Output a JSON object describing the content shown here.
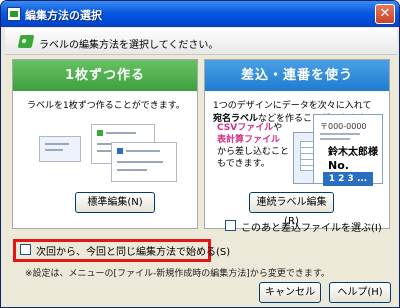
{
  "window": {
    "title": "編集方法の選択",
    "close_glyph": "✕"
  },
  "header": {
    "instruction": "ラベルの編集方法を選択してください。"
  },
  "panel_single": {
    "title": "1枚ずつ作る",
    "description": "ラベルを1枚ずつ作ることができます。",
    "button_label": "標準編集(N)"
  },
  "panel_merge": {
    "title": "差込・連番を使う",
    "description_line1": "1つのデザインにデータを次々に入れて",
    "description_bold": "宛名ラベル",
    "description_line2_rest": "などを作ることができます。",
    "csv_line1": "CSVファイル",
    "csv_line1_suffix": "や",
    "csv_line2": "表計算ファイル",
    "csv_line3": "から差し込むこと",
    "csv_line4": "もできます。",
    "illustration": {
      "zip": "〒000-0000",
      "name": "鈴木太郎様",
      "no": "No.",
      "sequence": "1 2 3 ..."
    },
    "button_label": "連続ラベル編集(R)",
    "checkbox_label": "このあと差込ファイルを選ぶ(I)"
  },
  "footer": {
    "remember_checkbox_label": "次回から、今回と同じ編集方法で始める(S)",
    "note": "※設定は、メニューの[ファイル-新規作成時の編集方法]から変更できます。",
    "cancel_label": "キャンセル",
    "help_label": "ヘルプ(H)"
  },
  "colors": {
    "left_accent": "#3ea03e",
    "right_accent": "#1f7cd0",
    "highlight": "#e01818"
  }
}
